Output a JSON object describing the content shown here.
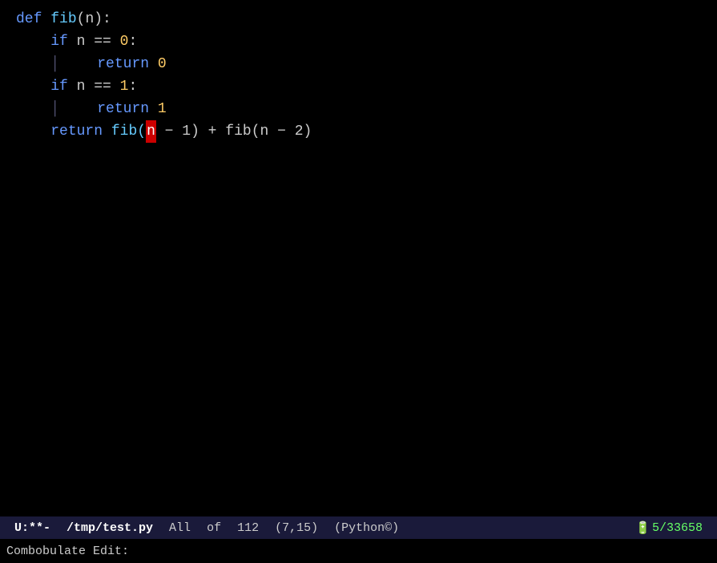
{
  "editor": {
    "background": "#000000",
    "lines": [
      {
        "tokens": [
          {
            "text": "def ",
            "class": "kw"
          },
          {
            "text": "fib",
            "class": "fn"
          },
          {
            "text": "(",
            "class": "paren"
          },
          {
            "text": "n",
            "class": "param"
          },
          {
            "text": "):",
            "class": "paren"
          }
        ]
      },
      {
        "tokens": [
          {
            "text": "    "
          },
          {
            "text": "if ",
            "class": "kw"
          },
          {
            "text": "n",
            "class": "param"
          },
          {
            "text": " == ",
            "class": "op"
          },
          {
            "text": "0",
            "class": "num"
          },
          {
            "text": ":",
            "class": "op"
          }
        ]
      },
      {
        "tokens": [
          {
            "text": "    "
          },
          {
            "text": "│",
            "class": "bar"
          },
          {
            "text": "    "
          },
          {
            "text": "return ",
            "class": "ret"
          },
          {
            "text": "0",
            "class": "num"
          }
        ]
      },
      {
        "tokens": [
          {
            "text": "    "
          },
          {
            "text": "if ",
            "class": "kw"
          },
          {
            "text": "n",
            "class": "param"
          },
          {
            "text": " == ",
            "class": "op"
          },
          {
            "text": "1",
            "class": "num"
          },
          {
            "text": ":",
            "class": "op"
          }
        ]
      },
      {
        "tokens": [
          {
            "text": "    "
          },
          {
            "text": "│",
            "class": "bar"
          },
          {
            "text": "    "
          },
          {
            "text": "return ",
            "class": "ret"
          },
          {
            "text": "1",
            "class": "num"
          }
        ]
      },
      {
        "tokens": [
          {
            "text": "    "
          },
          {
            "text": "return ",
            "class": "ret"
          },
          {
            "text": "fib(",
            "class": "fn"
          },
          {
            "text": "CURSOR",
            "class": "cursor"
          },
          {
            "text": " − 1) + fib(n − 2)",
            "class": "op"
          }
        ]
      }
    ]
  },
  "status_bar": {
    "modified": "U:**-",
    "filepath": "/tmp/test.py",
    "all_label": "All",
    "of_label": "of",
    "line_count": "112",
    "position": "(7,15)",
    "filetype": "(Python©)",
    "battery_value": "5",
    "session_id": "33658"
  },
  "command_line": {
    "text": "Combobulate Edit:"
  }
}
